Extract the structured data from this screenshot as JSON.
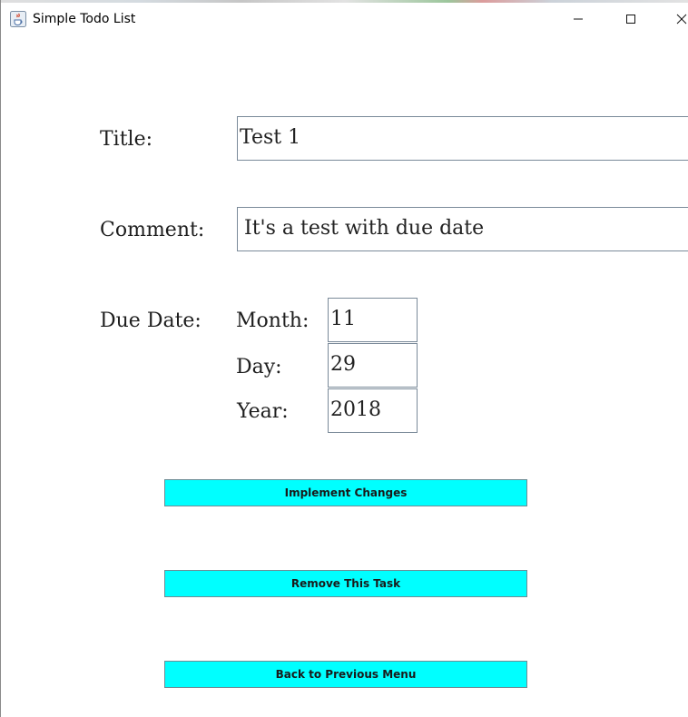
{
  "window": {
    "title": "Simple Todo List"
  },
  "form": {
    "title_label": "Title:",
    "title_value": "Test 1",
    "comment_label": "Comment:",
    "comment_value": "It's a test with due date",
    "due_date_label": "Due Date:",
    "month_label": "Month:",
    "month_value": "11",
    "day_label": "Day:",
    "day_value": "29",
    "year_label": "Year:",
    "year_value": "2018"
  },
  "buttons": {
    "implement": "Implement Changes",
    "remove": "Remove This Task",
    "back": "Back to Previous Menu"
  },
  "icons": {
    "app": "java-coffee-cup-icon",
    "minimize": "minimize-icon",
    "maximize": "maximize-icon",
    "close": "close-icon"
  },
  "colors": {
    "button_bg": "#00ffff",
    "field_border": "#7a8a99"
  }
}
